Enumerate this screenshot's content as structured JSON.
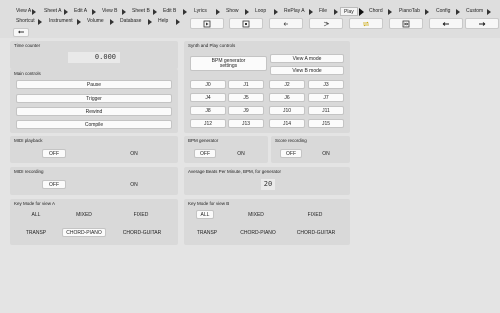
{
  "menu": {
    "row1": [
      "View A",
      "Sheet A",
      "Edit A",
      "View B",
      "Sheet B",
      "Edit B",
      "Lyrics",
      "Show",
      "Loop",
      "RePlay A",
      "File",
      "Play",
      "Chord",
      "PianoTab",
      "Config",
      "Custom"
    ],
    "row2": [
      "Shortcut",
      "Instrument",
      "Volume",
      "Database",
      "Help"
    ],
    "active": "Play"
  },
  "toolbar_icons": [
    "play-icon",
    "stop-icon",
    "back-icon",
    "rewind-icon",
    "shuffle-icon",
    "forward-icon",
    "repeat-icon",
    "loop-icon",
    "left-arrow-icon",
    "right-arrow-icon"
  ],
  "time_counter": {
    "title": "Time counter",
    "value": "0.000"
  },
  "main_controls": {
    "title": "Main controls",
    "pause": "Pause",
    "trigger": "Trigger",
    "rewind": "Rewind",
    "compile": "Compile"
  },
  "synth": {
    "title": "Synth and Play controls",
    "bpm_generator": "BPM generator settings",
    "view_a_mode": "View A mode",
    "view_b_mode": "View B mode",
    "j_buttons": [
      "J0",
      "J1",
      "J2",
      "J3",
      "J4",
      "J5",
      "J6",
      "J7",
      "J8",
      "J9",
      "J10",
      "J11",
      "J12",
      "J13",
      "J14",
      "J15"
    ]
  },
  "midi_playback": {
    "title": "MIDI playback",
    "off": "OFF",
    "on": "ON"
  },
  "bpm_gen": {
    "title": "BPM generator",
    "off": "OFF",
    "on": "ON"
  },
  "score_rec": {
    "title": "Score recording",
    "off": "OFF",
    "on": "ON"
  },
  "midi_recording": {
    "title": "MIDI recording",
    "off": "OFF",
    "on": "ON"
  },
  "avg_bpm": {
    "title": "Average Beats Per Minute, BPM, for generator",
    "value": "20"
  },
  "key_mode_a": {
    "title": "Key Mode for view A",
    "options": [
      "ALL",
      "MIXED",
      "FIXED",
      "TRANSP",
      "CHORD-PIANO",
      "CHORD-GUITAR"
    ],
    "selected": "CHORD-PIANO"
  },
  "key_mode_b": {
    "title": "Key Mode for view B",
    "options": [
      "ALL",
      "MIXED",
      "FIXED",
      "TRANSP",
      "CHORD-PIANO",
      "CHORD-GUITAR"
    ],
    "selected": "ALL"
  }
}
